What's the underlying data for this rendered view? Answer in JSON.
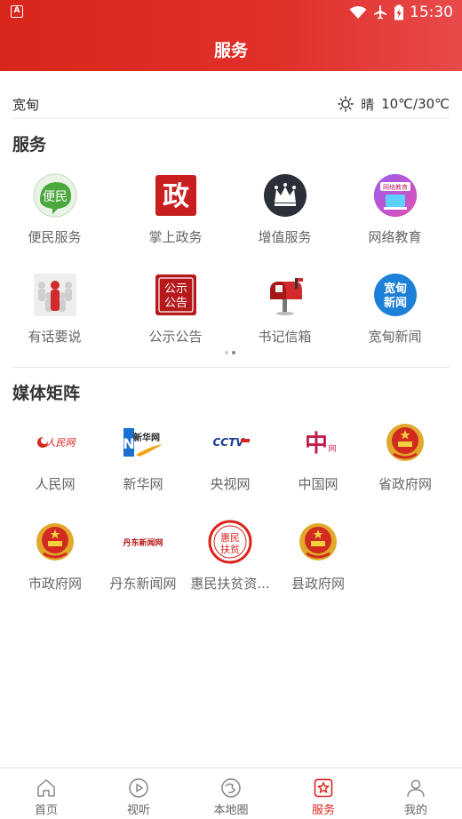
{
  "status": {
    "app_glyph": "A",
    "time": "15:30"
  },
  "header": {
    "title": "服务"
  },
  "location": {
    "name": "宽甸",
    "weather_condition": "晴",
    "temperature": "10℃/30℃"
  },
  "services": {
    "title": "服务",
    "items": [
      {
        "label": "便民服务",
        "icon": "bianmin-icon",
        "glyph": "便民"
      },
      {
        "label": "掌上政务",
        "icon": "zheng-icon",
        "glyph": "政"
      },
      {
        "label": "增值服务",
        "icon": "crown-icon"
      },
      {
        "label": "网络教育",
        "icon": "online-education-icon",
        "glyph": "网络教育"
      },
      {
        "label": "有话要说",
        "icon": "crowd-speak-icon"
      },
      {
        "label": "公示公告",
        "icon": "notice-icon",
        "glyph1": "公示",
        "glyph2": "公告"
      },
      {
        "label": "书记信箱",
        "icon": "mailbox-icon"
      },
      {
        "label": "宽甸新闻",
        "icon": "kuandian-news-icon",
        "glyph1": "宽甸",
        "glyph2": "新闻"
      }
    ]
  },
  "media": {
    "title": "媒体矩阵",
    "items": [
      {
        "label": "人民网",
        "icon": "people-net-logo-icon",
        "logo_text": "人民网"
      },
      {
        "label": "新华网",
        "icon": "xinhua-net-logo-icon",
        "logo_text": "新华网"
      },
      {
        "label": "央视网",
        "icon": "cctv-logo-icon",
        "logo_text": "CCTV"
      },
      {
        "label": "中国网",
        "icon": "china-net-logo-icon",
        "logo_text": "中国网"
      },
      {
        "label": "省政府网",
        "icon": "national-emblem-icon"
      },
      {
        "label": "市政府网",
        "icon": "national-emblem-icon"
      },
      {
        "label": "丹东新闻网",
        "icon": "dandong-news-logo-icon",
        "logo_text": "丹东新闻网"
      },
      {
        "label": "惠民扶贫资...",
        "icon": "huimin-fupin-seal-icon",
        "logo_text1": "惠民",
        "logo_text2": "扶贫"
      },
      {
        "label": "县政府网",
        "icon": "national-emblem-icon"
      }
    ]
  },
  "tabs": [
    {
      "label": "首页",
      "icon": "home-icon",
      "active": false
    },
    {
      "label": "视听",
      "icon": "play-icon",
      "active": false
    },
    {
      "label": "本地圈",
      "icon": "local-circle-icon",
      "active": false
    },
    {
      "label": "服务",
      "icon": "star-icon",
      "active": true
    },
    {
      "label": "我的",
      "icon": "user-icon",
      "active": false
    }
  ],
  "colors": {
    "brand_red": "#d9261c",
    "text": "#333333",
    "muted": "#666666"
  }
}
